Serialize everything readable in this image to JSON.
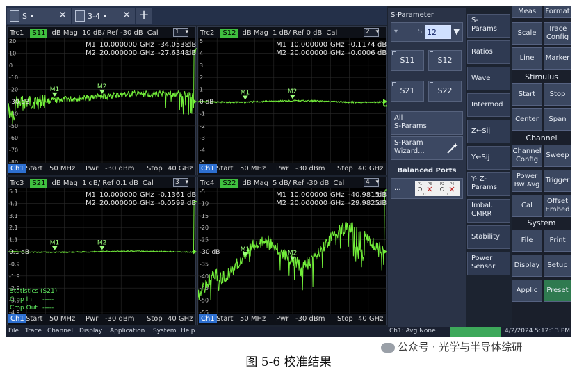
{
  "tabs": [
    {
      "label": "S •"
    },
    {
      "label": "3-4 •"
    }
  ],
  "colors": {
    "trace": "#73ef3a",
    "active_param": "#3fbf3f",
    "channel": "#2d6fd0",
    "highlight_button": "#2f7a50"
  },
  "diagrams": [
    {
      "trace": "Trc1",
      "param": "S11",
      "format": "dB Mag",
      "scale": "10 dB/ Ref -30 dB",
      "cal": "Cal",
      "num": "1",
      "yticks": [
        "20",
        "10",
        "0",
        "-10",
        "-20",
        "-30",
        "-40",
        "-50",
        "-60",
        "-70",
        "-80"
      ],
      "ref_label": "-30 dB",
      "markers": [
        {
          "id": "M1",
          "freq": "10.000000",
          "unit": "GHz",
          "value": "-34.0538",
          "vunit": "dB"
        },
        {
          "id": "M2",
          "freq": "20.000000",
          "unit": "GHz",
          "value": "-27.6348",
          "vunit": "dB"
        }
      ],
      "channel": {
        "tag": "Ch1",
        "start": "Start",
        "start_val": "50 MHz",
        "pwr": "Pwr",
        "pwr_val": "-30 dBm",
        "stop": "Stop",
        "stop_val": "40 GHz"
      }
    },
    {
      "trace": "Trc2",
      "param": "S12",
      "format": "dB Mag",
      "scale": "1 dB/ Ref 0 dB",
      "cal": "Cal",
      "num": "2",
      "yticks": [
        "5",
        "4",
        "3",
        "2",
        "1",
        "0",
        "-1",
        "-2",
        "-3",
        "-4",
        "-5"
      ],
      "ref_label": "0 dB",
      "markers": [
        {
          "id": "M1",
          "freq": "10.000000",
          "unit": "GHz",
          "value": "-0.1174",
          "vunit": "dB"
        },
        {
          "id": "M2",
          "freq": "20.000000",
          "unit": "GHz",
          "value": "-0.0006",
          "vunit": "dB"
        }
      ],
      "channel": {
        "tag": "Ch1",
        "start": "Start",
        "start_val": "50 MHz",
        "pwr": "Pwr",
        "pwr_val": "-30 dBm",
        "stop": "Stop",
        "stop_val": "40 GHz"
      }
    },
    {
      "trace": "Trc3",
      "param": "S21",
      "format": "dB Mag",
      "scale": "1 dB/ Ref 0.1 dB",
      "cal": "Cal",
      "num": "3",
      "yticks": [
        "5.1",
        "4.1",
        "3.1",
        "2.1",
        "1.1",
        "0.1",
        "-0.9",
        "-1.9",
        "-2.9",
        "-3.9",
        "-4.9"
      ],
      "ref_label": "0.1 dB",
      "markers": [
        {
          "id": "M1",
          "freq": "10.000000",
          "unit": "GHz",
          "value": "-0.1361",
          "vunit": "dB"
        },
        {
          "id": "M2",
          "freq": "20.000000",
          "unit": "GHz",
          "value": "-0.0599",
          "vunit": "dB"
        }
      ],
      "stats": {
        "title": "Statistics  (S21)",
        "cmp_in": "Cmp In",
        "cmp_out": "Cmp Out",
        "dash": "-----"
      },
      "channel": {
        "tag": "Ch1",
        "start": "Start",
        "start_val": "50 MHz",
        "pwr": "Pwr",
        "pwr_val": "-30 dBm",
        "stop": "Stop",
        "stop_val": "40 GHz"
      }
    },
    {
      "trace": "Trc4",
      "param": "S22",
      "format": "dB Mag",
      "scale": "5 dB/ Ref -30 dB",
      "cal": "Cal",
      "num": "4",
      "yticks": [
        "-5",
        "-10",
        "-15",
        "-20",
        "-25",
        "-30",
        "-35",
        "-40",
        "-45",
        "-50",
        "-55"
      ],
      "ref_label": "-30 dB",
      "markers": [
        {
          "id": "M1",
          "freq": "10.000000",
          "unit": "GHz",
          "value": "-40.9815",
          "vunit": "dB"
        },
        {
          "id": "M2",
          "freq": "20.000000",
          "unit": "GHz",
          "value": "-29.9825",
          "vunit": "dB"
        }
      ],
      "channel": {
        "tag": "Ch1",
        "start": "Start",
        "start_val": "50 MHz",
        "pwr": "Pwr",
        "pwr_val": "-30 dBm",
        "stop": "Stop",
        "stop_val": "40 GHz"
      }
    }
  ],
  "status_bar": {
    "menus": [
      "File",
      "Trace",
      "Channel",
      "Display",
      "Application",
      "System",
      "Help"
    ],
    "channel_info": "Ch1: Avg None",
    "datetime": "4/2/2024 5:12:13 PM"
  },
  "sparam_panel": {
    "title": "S-Parameter",
    "s_label": "S",
    "value": "12",
    "buttons": [
      "S11",
      "S12",
      "S21",
      "S22"
    ],
    "all_sparams": [
      "All",
      "S-Params"
    ],
    "wizard": [
      "S-Param",
      "Wizard..."
    ],
    "balanced_title": "Balanced Ports",
    "balanced_dots": "...",
    "port_labels": [
      "P1",
      "P3",
      "P2",
      "P4"
    ],
    "port_sub": [
      "LT",
      "LT"
    ]
  },
  "softkeys": [
    [
      "S-",
      "Params"
    ],
    [
      "Ratios"
    ],
    [
      "Wave"
    ],
    [
      "Intermod"
    ],
    [
      "Z←Sij"
    ],
    [
      "Y←Sij"
    ],
    [
      "Y- Z-",
      "Params"
    ],
    [
      "Imbal.",
      "CMRR"
    ],
    [
      "Stability"
    ],
    [
      "Power",
      "Sensor"
    ]
  ],
  "hardkeys": {
    "top": [
      {
        "key": "meas",
        "label": "Meas"
      },
      {
        "key": "format",
        "label": "Format"
      },
      {
        "key": "scale",
        "label": "Scale"
      },
      {
        "key": "trace-config",
        "label": "Trace Config"
      },
      {
        "key": "line",
        "label": "Line"
      },
      {
        "key": "marker",
        "label": "Marker"
      }
    ],
    "stimulus_title": "Stimulus",
    "stimulus": [
      {
        "key": "start",
        "label": "Start"
      },
      {
        "key": "stop",
        "label": "Stop"
      },
      {
        "key": "center",
        "label": "Center"
      },
      {
        "key": "span",
        "label": "Span"
      }
    ],
    "channel_title": "Channel",
    "channel": [
      {
        "key": "channel-config",
        "label": "Channel Config"
      },
      {
        "key": "sweep",
        "label": "Sweep"
      },
      {
        "key": "power-bw-avg",
        "label": "Power Bw Avg"
      },
      {
        "key": "trigger",
        "label": "Trigger"
      },
      {
        "key": "cal",
        "label": "Cal"
      },
      {
        "key": "offset-embed",
        "label": "Offset Embed"
      }
    ],
    "system_title": "System",
    "system": [
      {
        "key": "file",
        "label": "File"
      },
      {
        "key": "print",
        "label": "Print"
      },
      {
        "key": "display",
        "label": "Display"
      },
      {
        "key": "setup",
        "label": "Setup"
      },
      {
        "key": "applic",
        "label": "Applic"
      },
      {
        "key": "preset",
        "label": "Preset"
      }
    ]
  },
  "caption": "图 5-6 校准结果",
  "watermark": "公众号 · 光学与半导体综研"
}
